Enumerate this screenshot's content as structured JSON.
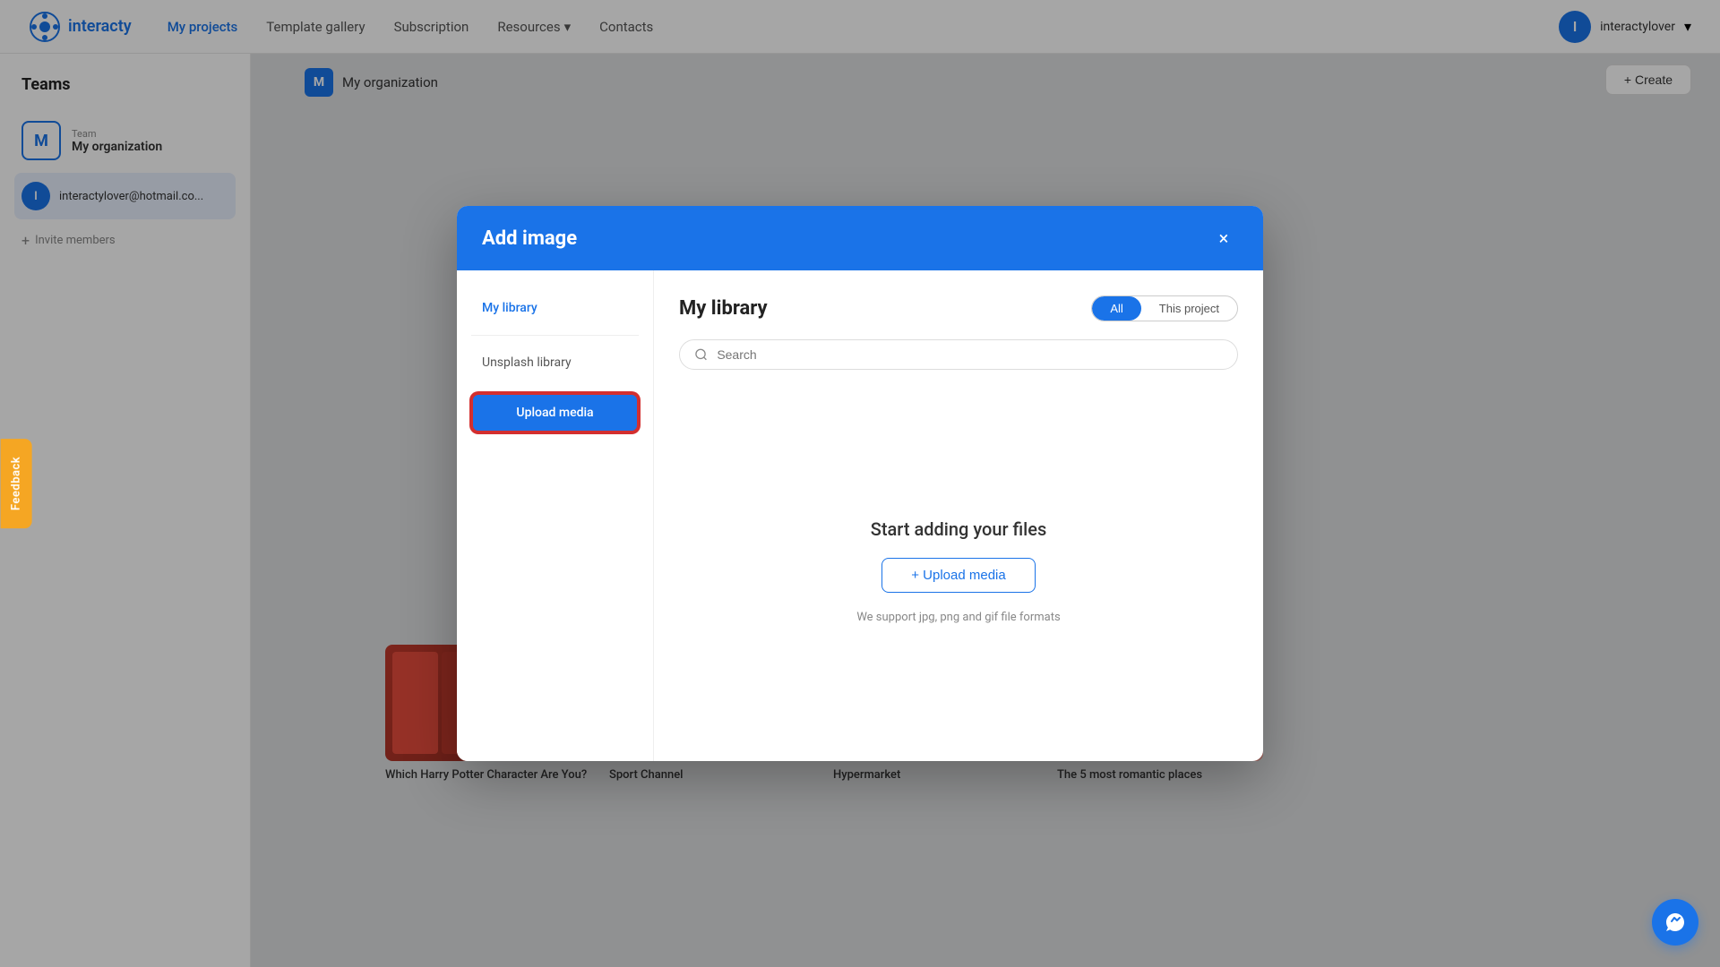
{
  "app": {
    "logo_text": "interacty",
    "favicon": "✦"
  },
  "navbar": {
    "links": [
      {
        "label": "My projects",
        "active": true
      },
      {
        "label": "Template gallery",
        "active": false
      },
      {
        "label": "Subscription",
        "active": false
      },
      {
        "label": "Resources",
        "active": false,
        "has_dropdown": true
      },
      {
        "label": "Contacts",
        "active": false
      }
    ],
    "user": {
      "avatar_letter": "I",
      "name": "interactylover",
      "has_dropdown": true
    }
  },
  "sidebar": {
    "title": "Teams",
    "team": {
      "avatar_letter": "M",
      "label": "Team",
      "name": "My organization"
    },
    "user_email": "interactylover@hotmail.co...",
    "user_avatar_letter": "I",
    "invite_label": "Invite members"
  },
  "org_header": {
    "avatar_letter": "M",
    "name": "My organization"
  },
  "create_button": "+ Create",
  "modal": {
    "title": "Add image",
    "close_label": "×",
    "sidebar": {
      "my_library_label": "My library",
      "unsplash_library_label": "Unsplash library",
      "upload_button_label": "Upload media"
    },
    "content": {
      "section_title": "My library",
      "filter_all": "All",
      "filter_this_project": "This project",
      "search_placeholder": "Search",
      "empty_title": "Start adding your files",
      "upload_cta_label": "+ Upload media",
      "supported_formats": "We support jpg, png and gif file formats"
    }
  },
  "background_cards": [
    {
      "title": "Which Harry Potter Character Are You?",
      "color": "red"
    },
    {
      "title": "Sport Channel",
      "color": "sport"
    },
    {
      "title": "Hypermarket",
      "color": "market"
    },
    {
      "title": "The 5 most romantic places",
      "color": "romantic"
    }
  ],
  "feedback_label": "Feedback",
  "messenger_icon": "💬"
}
